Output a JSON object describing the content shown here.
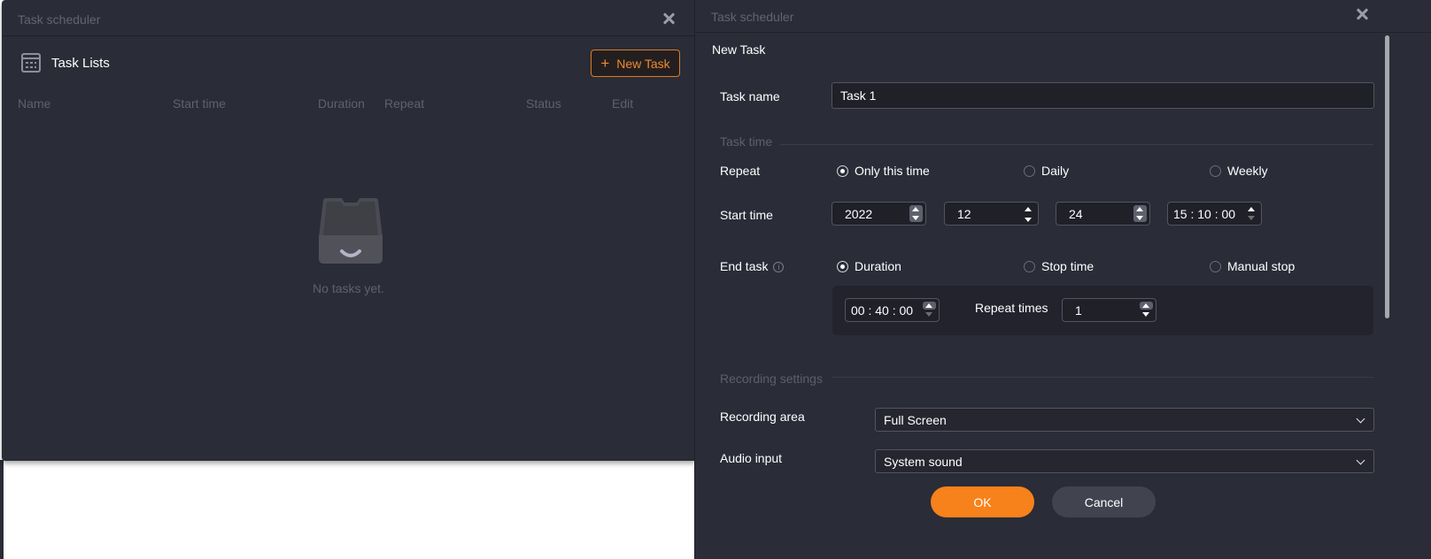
{
  "left_window": {
    "title": "Task scheduler",
    "header_title": "Task Lists",
    "new_task_label": "New Task",
    "new_task_icon": "+",
    "columns": [
      "Name",
      "Start time",
      "Duration",
      "Repeat",
      "Status",
      "Edit"
    ],
    "empty_text": "No tasks yet.",
    "accent": "#f08a2c"
  },
  "right_window": {
    "title": "Task scheduler",
    "heading": "New Task",
    "task_name_label": "Task name",
    "task_name_value": "Task 1",
    "task_time_section": "Task time",
    "repeat_label": "Repeat",
    "repeat_options": [
      {
        "label": "Only this time",
        "selected": true
      },
      {
        "label": "Daily",
        "selected": false
      },
      {
        "label": "Weekly",
        "selected": false
      }
    ],
    "start_time_label": "Start time",
    "start_year": "2022",
    "start_month": "12",
    "start_day": "24",
    "start_clock": "15 : 10 : 00",
    "end_task_label": "End task",
    "end_options": [
      {
        "label": "Duration",
        "selected": true
      },
      {
        "label": "Stop time",
        "selected": false
      },
      {
        "label": "Manual stop",
        "selected": false
      }
    ],
    "duration_value": "00 : 40 : 00",
    "repeat_times_label": "Repeat times",
    "repeat_times_value": "1",
    "recording_section": "Recording settings",
    "recording_area_label": "Recording area",
    "recording_area_value": "Full Screen",
    "audio_input_label": "Audio input",
    "audio_input_value": "System sound",
    "ok_label": "OK",
    "cancel_label": "Cancel",
    "accent": "#f7811a"
  }
}
